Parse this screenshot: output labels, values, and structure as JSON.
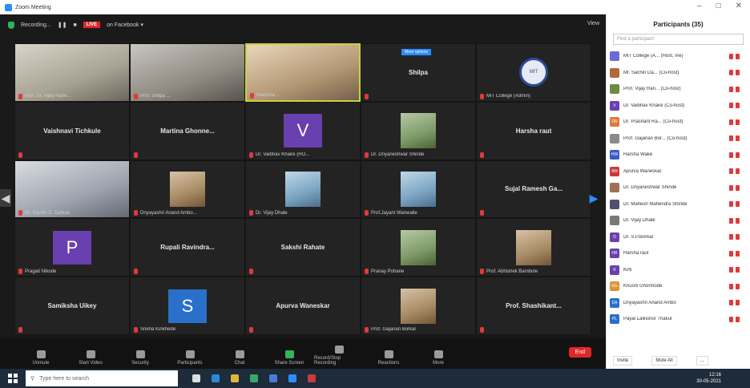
{
  "window": {
    "title": "Zoom Meeting",
    "min": "–",
    "max": "□",
    "close": "✕"
  },
  "topbar": {
    "recording": "Recording...",
    "live_badge": "LIVE",
    "live_on": "on Facebook ▾",
    "view": "View"
  },
  "tiles": [
    {
      "kind": "video",
      "label": "Prof. Dr. Vijay Rane...",
      "photo": "p1"
    },
    {
      "kind": "video",
      "label": "Prof. Shilpa ...",
      "photo": "p2"
    },
    {
      "kind": "video",
      "label": "Manisha ...",
      "photo": "p3",
      "active": true
    },
    {
      "kind": "name",
      "name": "Shilpa",
      "badge": "More options"
    },
    {
      "kind": "logo",
      "label": "MIT College (Admin)",
      "logo_text": "MIT"
    },
    {
      "kind": "name",
      "name": "Vaishnavi Tichkule"
    },
    {
      "kind": "name",
      "name": "Martina  Ghonne..."
    },
    {
      "kind": "avatar",
      "letter": "V",
      "color": "#6a3fb0",
      "label": "Dr. Vaibhav Khaire (HO..."
    },
    {
      "kind": "thumb",
      "thumb": "t1",
      "label": "Dr. Dnyaneshwar Shinde"
    },
    {
      "kind": "name",
      "name": "Harsha raut"
    },
    {
      "kind": "video",
      "label": "Dr. Sachin D. Dahule",
      "photo": "p4"
    },
    {
      "kind": "thumb",
      "thumb": "t3",
      "label": "Dnyayashri Anand Ambo..."
    },
    {
      "kind": "thumb",
      "thumb": "t2",
      "label": "Dr. Vijay Dhale"
    },
    {
      "kind": "thumb",
      "thumb": "t2",
      "label": "Prof.Jayant Wanwalle"
    },
    {
      "kind": "name",
      "name": "Sujal Ramesh Ga..."
    },
    {
      "kind": "avatar",
      "letter": "P",
      "color": "#6a3fb0",
      "label": "Pragati Nikode"
    },
    {
      "kind": "name",
      "name": "Rupali Ravindra..."
    },
    {
      "kind": "name",
      "name": "Sakshi Rahate"
    },
    {
      "kind": "thumb",
      "thumb": "t1",
      "label": "Pranay Pohane"
    },
    {
      "kind": "thumb",
      "thumb": "t3",
      "label": "Prof. Abhishek Bambole"
    },
    {
      "kind": "name",
      "name": "Samiksha Uikey"
    },
    {
      "kind": "avatar",
      "letter": "S",
      "color": "#2a6fc9",
      "label": "Sneha Kinkhede"
    },
    {
      "kind": "name",
      "name": "Apurva Waneskar"
    },
    {
      "kind": "thumb",
      "thumb": "t3",
      "label": "Prof. Gajanan Borkar"
    },
    {
      "kind": "name",
      "name": "Prof. Shashikant..."
    }
  ],
  "toolbar": {
    "buttons": [
      "Unmute",
      "Start Video",
      "Security",
      "Participants",
      "Chat",
      "Share Screen",
      "Record/Stop Recording",
      "Reactions",
      "More"
    ],
    "participants_count": "35",
    "end": "End"
  },
  "panel": {
    "title": "Participants (35)",
    "search_placeholder": "Find a participant",
    "participants": [
      {
        "name": "MIT College (A... (Host, me)",
        "color": "#6b6bd8",
        "initial": ""
      },
      {
        "name": "Mr. Sachin Da... (Co-host)",
        "color": "#b06a3a",
        "initial": ""
      },
      {
        "name": "Prof. Vijay Ran... (Co-host)",
        "color": "#6e8b3d",
        "initial": ""
      },
      {
        "name": "Dr. Vaibhav Khaire (Co-host)",
        "color": "#6a3fb0",
        "initial": "V"
      },
      {
        "name": "Dr. Prashant Ra... (Co-host)",
        "color": "#e07a3a",
        "initial": "DR"
      },
      {
        "name": "Prof. Gajanan Bor... (Co-host)",
        "color": "#8a8a8a",
        "initial": ""
      },
      {
        "name": "Harsha Wake",
        "color": "#3a5bc9",
        "initial": "HW"
      },
      {
        "name": "Apurva Waneskar",
        "color": "#c93a3a",
        "initial": "AW"
      },
      {
        "name": "Dr. Dnyaneshwar Shinde",
        "color": "#a07050",
        "initial": ""
      },
      {
        "name": "Dr. Mahesh Mahendra Shinde",
        "color": "#505070",
        "initial": ""
      },
      {
        "name": "Dr. Vijay Dhale",
        "color": "#7a7a7a",
        "initial": ""
      },
      {
        "name": "Dr. S.P.Borkar",
        "color": "#6a3fb0",
        "initial": "D"
      },
      {
        "name": "Harsha raut",
        "color": "#6a3fb0",
        "initial": "HR"
      },
      {
        "name": "Kirti",
        "color": "#6a3fb0",
        "initial": "K"
      },
      {
        "name": "Khushi Ghormode",
        "color": "#e0903a",
        "initial": "KG"
      },
      {
        "name": "Dnyayashri Anand Ambo",
        "color": "#2a6fc9",
        "initial": "DA"
      },
      {
        "name": "Payal Lalkishor Thakur",
        "color": "#2a6fc9",
        "initial": "PL"
      }
    ],
    "invite": "Invite",
    "mute_all": "Mute All",
    "more": "..."
  },
  "taskbar": {
    "search_placeholder": "Type here to search",
    "time": "12:16",
    "date": "30-05-2021"
  }
}
